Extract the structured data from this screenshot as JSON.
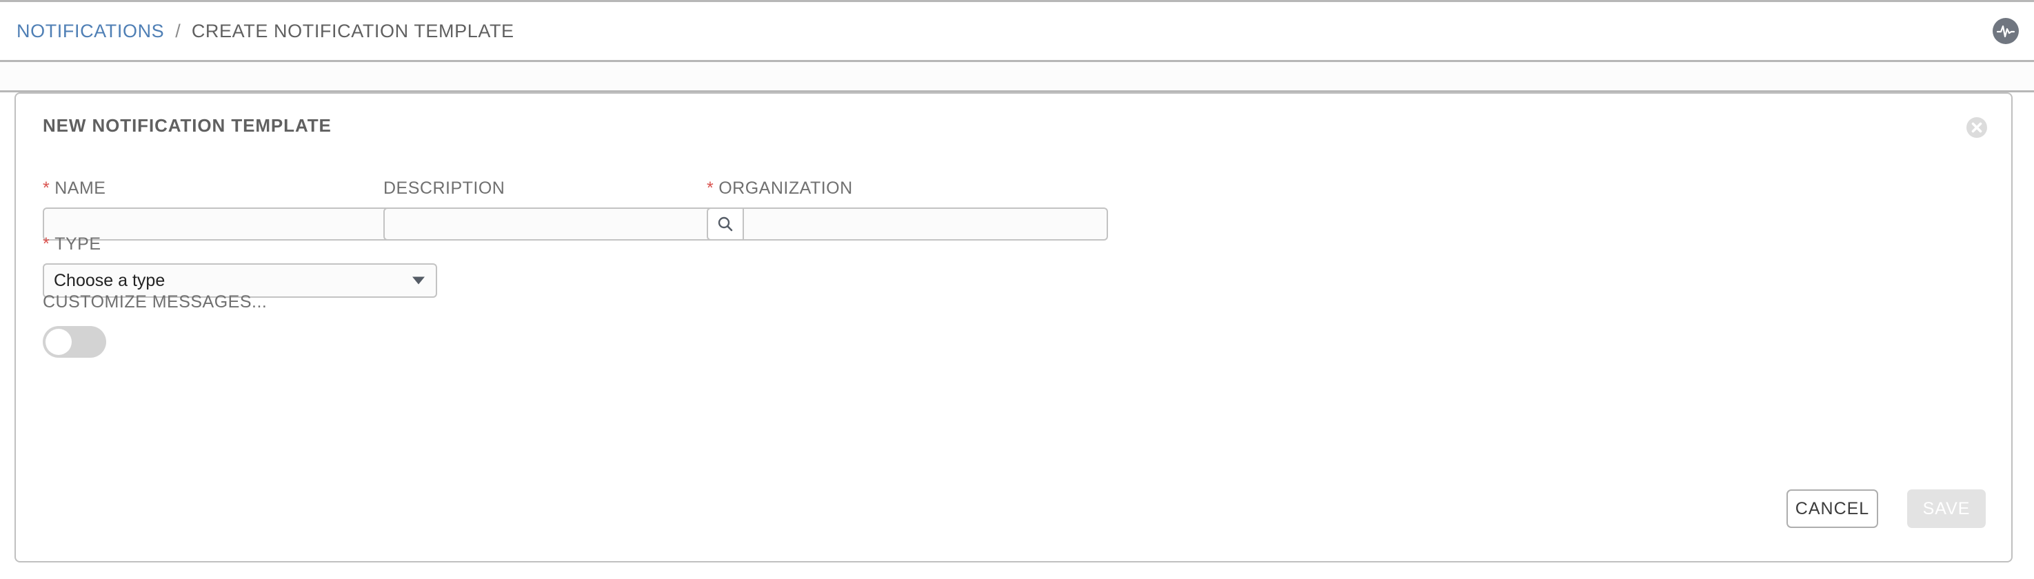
{
  "header": {
    "breadcrumb": {
      "parent": "NOTIFICATIONS",
      "separator": "/",
      "current": "CREATE NOTIFICATION TEMPLATE"
    },
    "activity_icon": "activity-pulse-icon"
  },
  "card": {
    "title": "NEW NOTIFICATION TEMPLATE",
    "close_icon": "close-circle-icon",
    "fields": {
      "name": {
        "label": "NAME",
        "required": true,
        "required_marker": "*",
        "value": "",
        "placeholder": ""
      },
      "description": {
        "label": "DESCRIPTION",
        "required": false,
        "value": "",
        "placeholder": ""
      },
      "organization": {
        "label": "ORGANIZATION",
        "required": true,
        "required_marker": "*",
        "value": "",
        "placeholder": "",
        "search_icon": "magnifier-icon"
      },
      "type": {
        "label": "TYPE",
        "required": true,
        "required_marker": "*",
        "selected": "Choose a type",
        "caret_icon": "chevron-down-icon"
      },
      "customize_messages": {
        "label": "CUSTOMIZE MESSAGES...",
        "enabled": false
      }
    },
    "actions": {
      "cancel_label": "CANCEL",
      "save_label": "SAVE",
      "save_disabled": true
    }
  },
  "colors": {
    "link": "#4f7fb5",
    "required": "#d9534f",
    "text": "#606060",
    "border": "#c0c0c0",
    "save_disabled_bg": "#e3e3e3"
  }
}
